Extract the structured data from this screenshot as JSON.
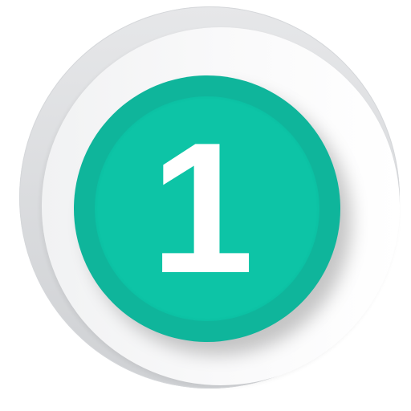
{
  "badge": {
    "number": "1",
    "colors": {
      "outer_ring": "#d5d7da",
      "plate": "#f6f6f7",
      "badge": "#0fb59b",
      "badge_inner": "#0dc4a6",
      "number": "#ffffff"
    }
  }
}
